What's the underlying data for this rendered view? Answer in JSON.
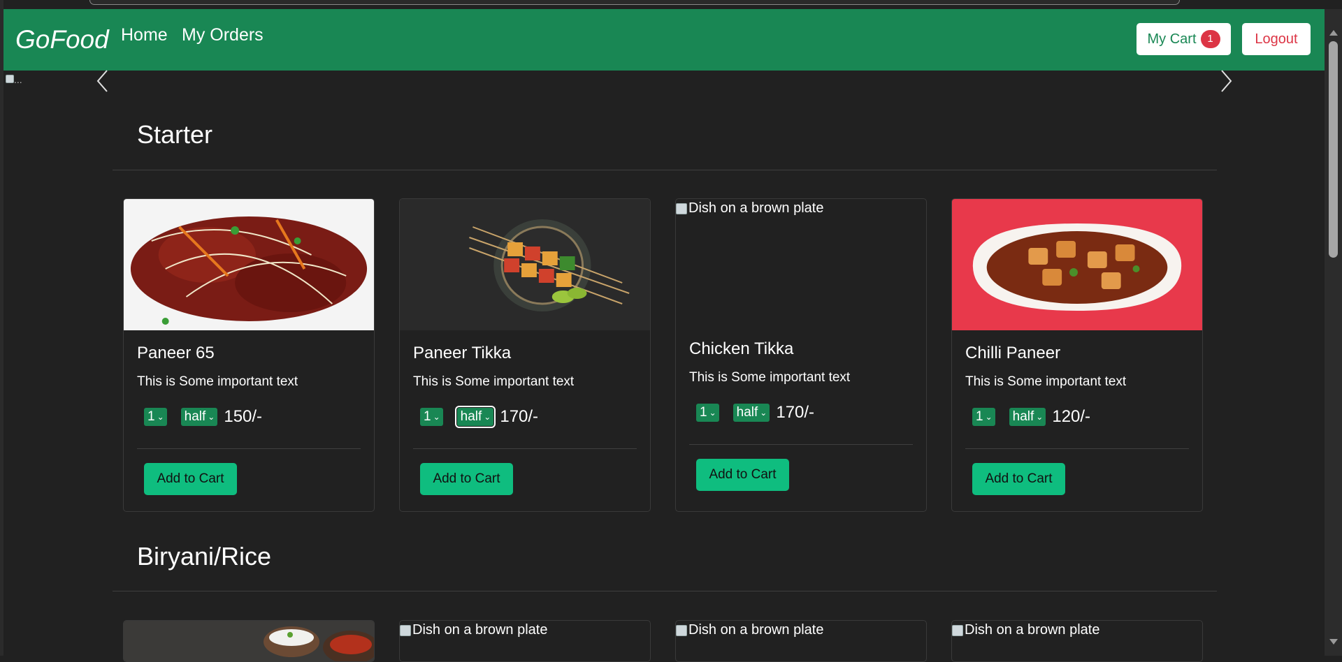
{
  "navbar": {
    "brand": "GoFood",
    "links": {
      "home": "Home",
      "orders": "My Orders"
    },
    "cart_label": "My Cart",
    "cart_count": "1",
    "logout_label": "Logout",
    "bg_color": "#198754"
  },
  "carousel": {
    "image_alt": "..."
  },
  "sections": {
    "starter": "Starter",
    "biryani": "Biryani/Rice"
  },
  "cards": [
    {
      "name": "Paneer 65",
      "description": "This is Some important text",
      "qty": "1",
      "size": "half",
      "price": "150/-",
      "add_label": "Add to Cart"
    },
    {
      "name": "Paneer Tikka",
      "description": "This is Some important text",
      "qty": "1",
      "size": "half",
      "price": "170/-",
      "add_label": "Add to Cart"
    },
    {
      "name": "Chicken Tikka",
      "description": "This is Some important text",
      "qty": "1",
      "size": "half",
      "price": "170/-",
      "add_label": "Add to Cart",
      "image_alt": "Dish on a brown plate"
    },
    {
      "name": "Chilli Paneer",
      "description": "This is Some important text",
      "qty": "1",
      "size": "half",
      "price": "120/-",
      "add_label": "Add to Cart"
    }
  ],
  "biryani_cards": [
    {
      "image_alt": "Dish on a brown plate"
    },
    {
      "image_alt": "Dish on a brown plate"
    },
    {
      "image_alt": "Dish on a brown plate"
    }
  ],
  "colors": {
    "accent": "#198754",
    "add_button": "#0fbd7f",
    "badge": "#dc3545",
    "page_bg": "#212121"
  }
}
